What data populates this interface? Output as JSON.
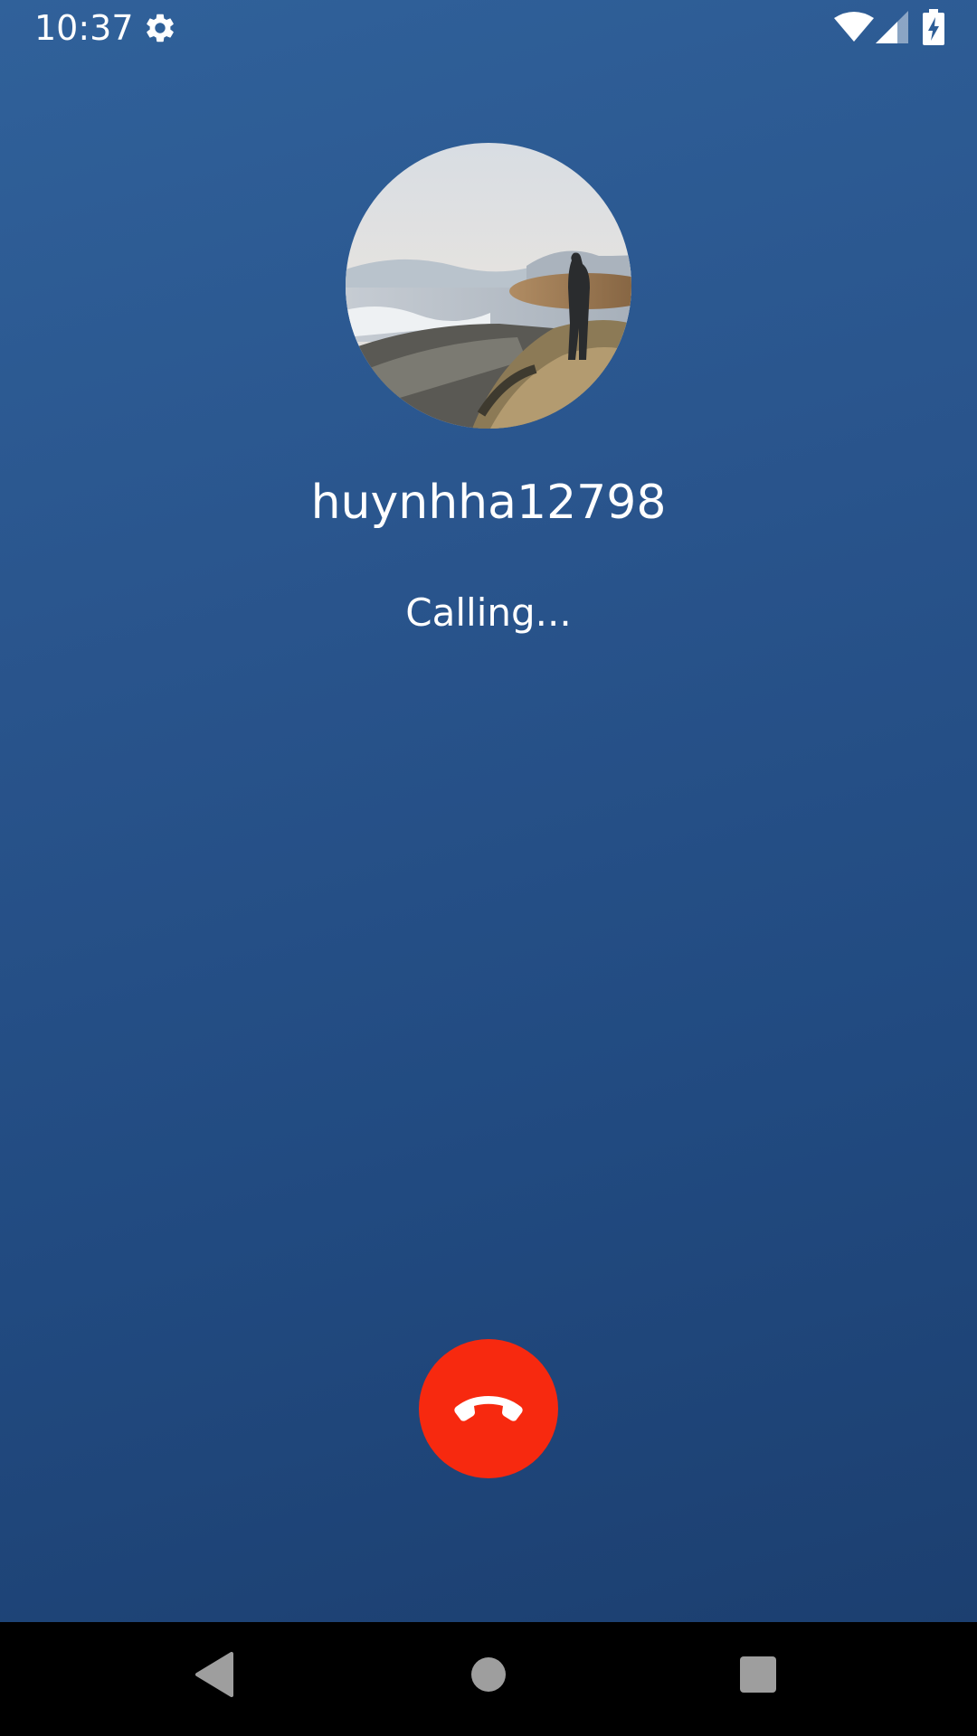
{
  "status_bar": {
    "time": "10:37",
    "icons": [
      "gear-icon",
      "wifi-icon",
      "signal-icon",
      "battery-charging-icon"
    ]
  },
  "call": {
    "caller_name": "huynhha12798",
    "status": "Calling...",
    "end_call_icon": "phone-hangup-icon"
  },
  "navigation": {
    "buttons": [
      "back-icon",
      "home-icon",
      "recents-icon"
    ]
  },
  "colors": {
    "background_top": "#30619a",
    "background_bottom": "#1b3d6d",
    "end_call": "#f7290f",
    "nav_bar": "#000000"
  }
}
